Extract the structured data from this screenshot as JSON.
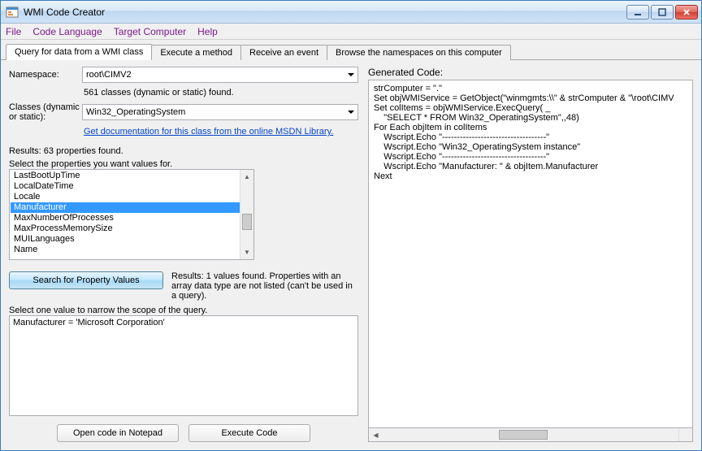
{
  "window": {
    "title": "WMI Code Creator"
  },
  "menu": {
    "file": "File",
    "codeLanguage": "Code Language",
    "targetComputer": "Target Computer",
    "help": "Help"
  },
  "tabs": {
    "query": "Query for data from a WMI class",
    "execute": "Execute a method",
    "receive": "Receive an event",
    "browse": "Browse the namespaces on this computer"
  },
  "left": {
    "namespaceLabel": "Namespace:",
    "namespaceValue": "root\\CIMV2",
    "classCount": "561 classes (dynamic or static) found.",
    "classesLabel": "Classes (dynamic or static):",
    "classValue": "Win32_OperatingSystem",
    "docLink": "Get documentation for this class from the online MSDN Library.",
    "resultsLabel": "Results:  63 properties found.",
    "selectPropsLabel": "Select the properties you want values for.",
    "properties": [
      "LastBootUpTime",
      "LocalDateTime",
      "Locale",
      "Manufacturer",
      "MaxNumberOfProcesses",
      "MaxProcessMemorySize",
      "MUILanguages",
      "Name"
    ],
    "selectedPropertyIndex": 3,
    "searchButton": "Search for Property Values",
    "valuesResults": "Results:  1 values found. Properties with an array data type are not listed (can't be used in a query).",
    "narrowLabel": "Select one value to narrow the scope of the query.",
    "queryValue": "Manufacturer = 'Microsoft Corporation'",
    "openNotepad": "Open code in Notepad",
    "executeCode": "Execute Code"
  },
  "right": {
    "generatedLabel": "Generated Code:",
    "code": "strComputer = \".\"\nSet objWMIService = GetObject(\"winmgmts:\\\\\" & strComputer & \"\\root\\CIMV\nSet colItems = objWMIService.ExecQuery( _\n    \"SELECT * FROM Win32_OperatingSystem\",,48)\nFor Each objItem in colItems\n    Wscript.Echo \"-----------------------------------\"\n    Wscript.Echo \"Win32_OperatingSystem instance\"\n    Wscript.Echo \"-----------------------------------\"\n    Wscript.Echo \"Manufacturer: \" & objItem.Manufacturer\nNext"
  }
}
